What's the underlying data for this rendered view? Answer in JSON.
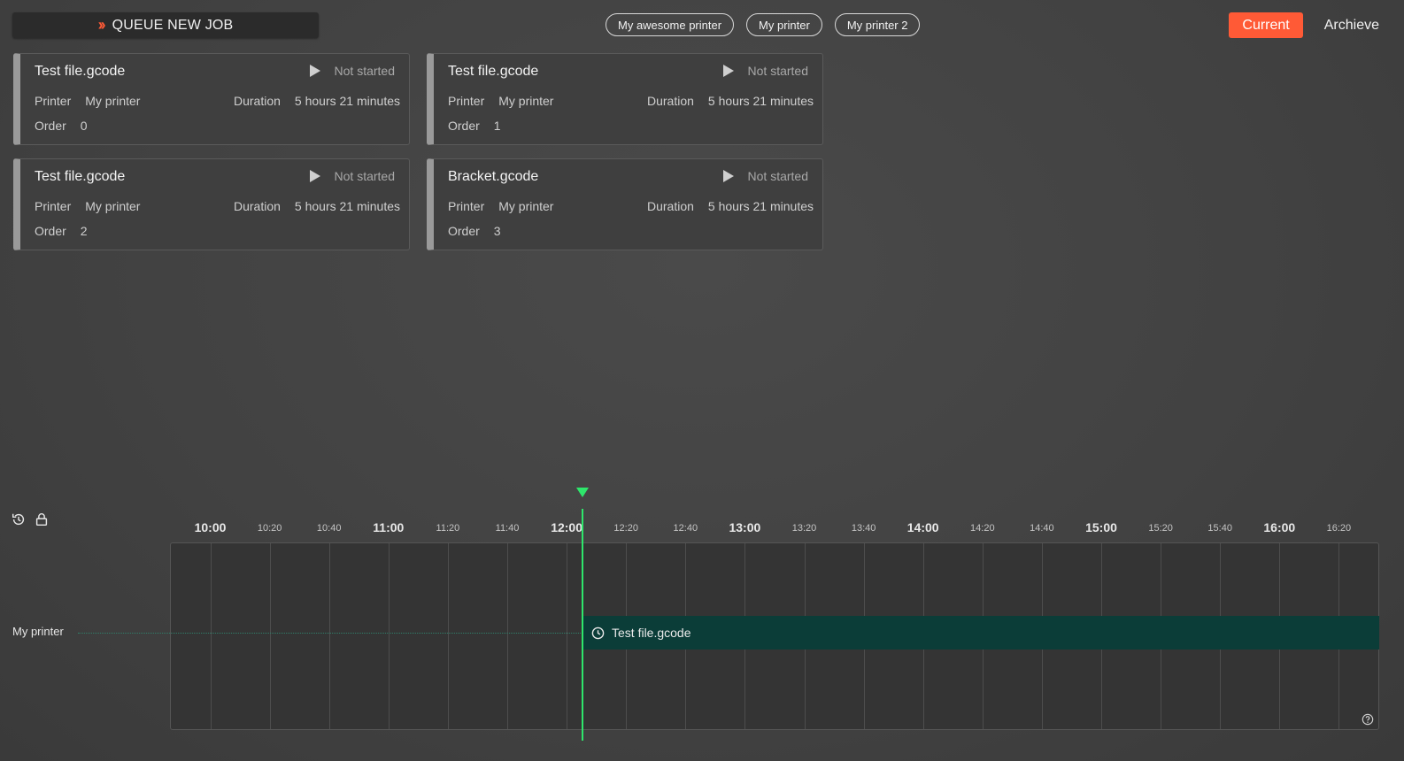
{
  "toolbar": {
    "queue_label": "QUEUE NEW JOB"
  },
  "printers": [
    "My awesome printer",
    "My printer",
    "My printer 2"
  ],
  "views": {
    "current": "Current",
    "archive": "Archieve"
  },
  "accent_color": "#ff5a36",
  "labels": {
    "printer": "Printer",
    "duration": "Duration",
    "order": "Order"
  },
  "jobs": [
    {
      "title": "Test file.gcode",
      "status": "Not started",
      "printer": "My printer",
      "duration": "5 hours 21 minutes",
      "order": "0"
    },
    {
      "title": "Test file.gcode",
      "status": "Not started",
      "printer": "My printer",
      "duration": "5 hours 21 minutes",
      "order": "1"
    },
    {
      "title": "Test file.gcode",
      "status": "Not started",
      "printer": "My printer",
      "duration": "5 hours 21 minutes",
      "order": "2"
    },
    {
      "title": "Bracket.gcode",
      "status": "Not started",
      "printer": "My printer",
      "duration": "5 hours 21 minutes",
      "order": "3"
    }
  ],
  "timeline": {
    "ticks": [
      {
        "t": "10:00",
        "major": true
      },
      {
        "t": "10:20",
        "major": false
      },
      {
        "t": "10:40",
        "major": false
      },
      {
        "t": "11:00",
        "major": true
      },
      {
        "t": "11:20",
        "major": false
      },
      {
        "t": "11:40",
        "major": false
      },
      {
        "t": "12:00",
        "major": true
      },
      {
        "t": "12:20",
        "major": false
      },
      {
        "t": "12:40",
        "major": false
      },
      {
        "t": "13:00",
        "major": true
      },
      {
        "t": "13:20",
        "major": false
      },
      {
        "t": "13:40",
        "major": false
      },
      {
        "t": "14:00",
        "major": true
      },
      {
        "t": "14:20",
        "major": false
      },
      {
        "t": "14:40",
        "major": false
      },
      {
        "t": "15:00",
        "major": true
      },
      {
        "t": "15:20",
        "major": false
      },
      {
        "t": "15:40",
        "major": false
      },
      {
        "t": "16:00",
        "major": true
      },
      {
        "t": "16:20",
        "major": false
      }
    ],
    "row_printer": "My printer",
    "scheduled_job": "Test file.gcode",
    "now_color": "#2ee66b",
    "job_bar_color": "#0b3d38"
  },
  "icons": [
    "double-chevron-right-icon",
    "play-icon",
    "history-icon",
    "lock-icon",
    "clock-icon",
    "help-icon",
    "now-marker-icon"
  ]
}
